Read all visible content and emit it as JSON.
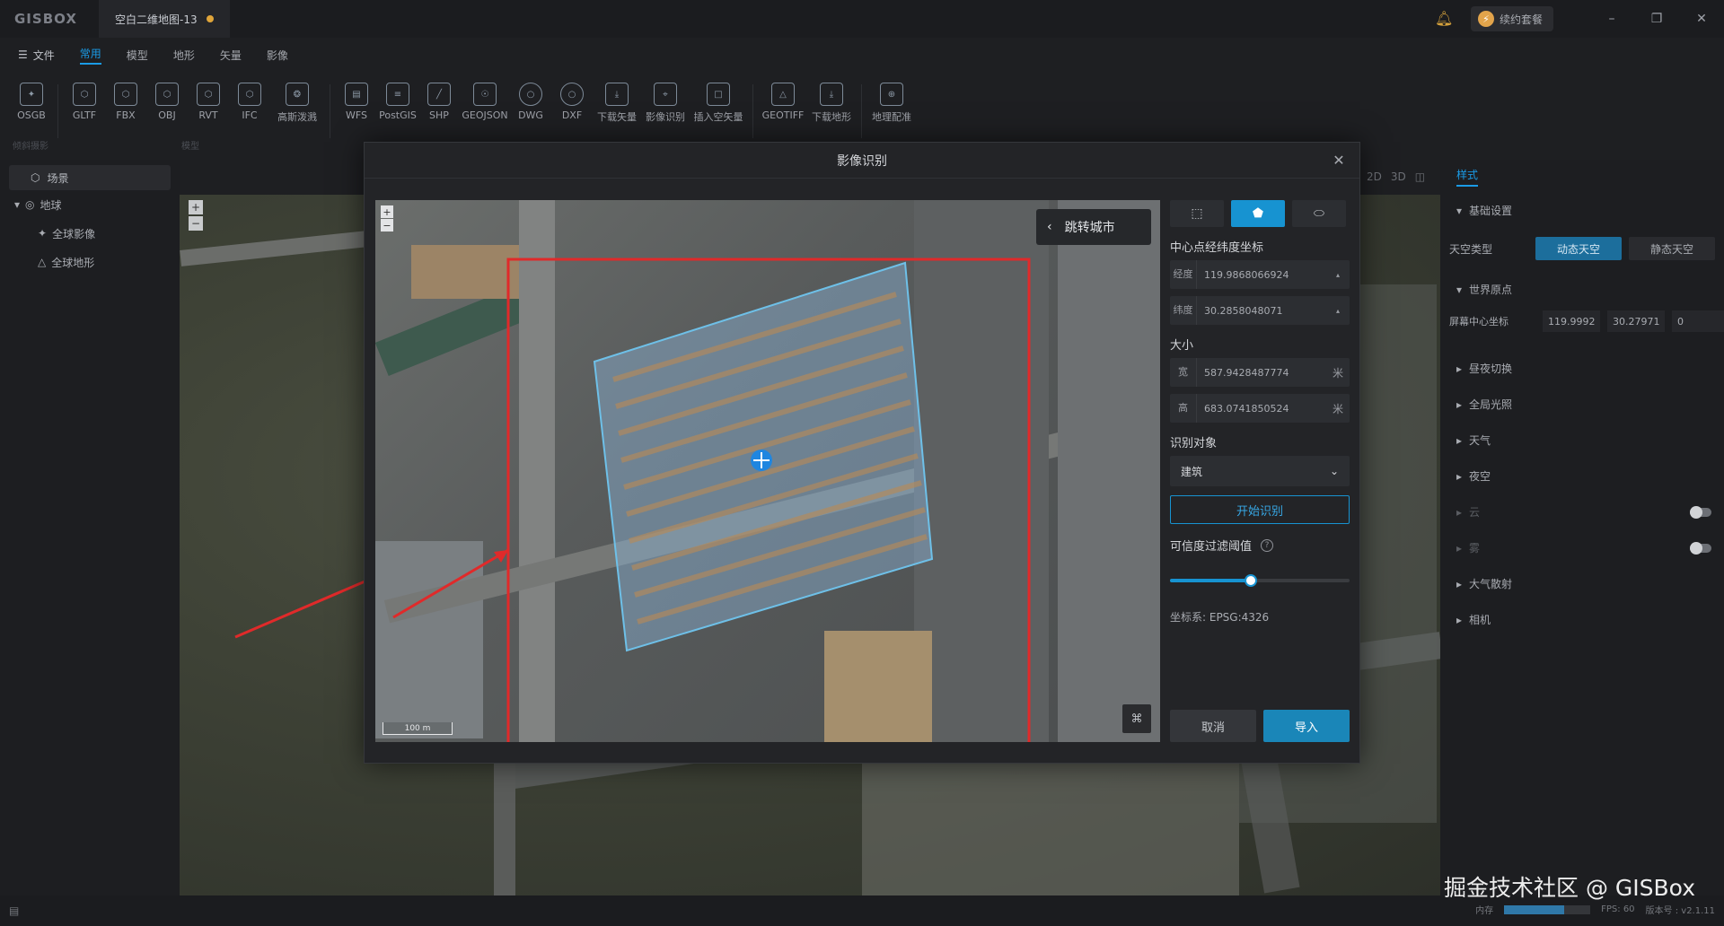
{
  "app": {
    "logo": "GISBOX",
    "doc_tab": "空白二维地图-13",
    "renew_label": "续约套餐",
    "renew_icon": "lightning-icon",
    "bell_icon": "bell-icon"
  },
  "menu": {
    "file": "文件",
    "tabs": [
      "常用",
      "模型",
      "地形",
      "矢量",
      "影像"
    ],
    "active_tab": "常用"
  },
  "ribbon": {
    "buttons": [
      "OSGB",
      "GLTF",
      "FBX",
      "OBJ",
      "RVT",
      "IFC",
      "高斯泼溅",
      "WFS",
      "PostGIS",
      "SHP",
      "GEOJSON",
      "DWG",
      "DXF",
      "下载矢量",
      "影像识别",
      "插入空矢量",
      "GEOTIFF",
      "下载地形",
      "地理配准"
    ],
    "groups": [
      "倾斜摄影",
      "模型"
    ]
  },
  "left_panel": {
    "header": "场景",
    "globe": "地球",
    "items": [
      "全球影像",
      "全球地形"
    ]
  },
  "view_modes": [
    "2D",
    "3D"
  ],
  "right_panel": {
    "tab": "样式",
    "basic": "基础设置",
    "sky_type_label": "天空类型",
    "sky_options": [
      "动态天空",
      "静态天空"
    ],
    "world_origin": "世界原点",
    "screen_center_label": "屏幕中心坐标",
    "screen_center": [
      "119.9992",
      "30.27971",
      "0"
    ],
    "sections": [
      "昼夜切换",
      "全局光照",
      "天气",
      "夜空",
      "云",
      "雾",
      "大气散射",
      "相机"
    ]
  },
  "modal": {
    "title": "影像识别",
    "jump_city": "跳转城市",
    "scale_text": "100 m",
    "center_label": "中心点经纬度坐标",
    "lon_prefix": "经度",
    "lon_value": "119.9868066924",
    "lat_prefix": "纬度",
    "lat_value": "30.2858048071",
    "size_label": "大小",
    "width_prefix": "宽",
    "width_value": "587.9428487774",
    "height_prefix": "高",
    "height_value": "683.0741850524",
    "unit": "米",
    "target_label": "识别对象",
    "target_value": "建筑",
    "start_button": "开始识别",
    "threshold_label": "可信度过滤阈值",
    "threshold_value": 0.45,
    "crs": "坐标系: EPSG:4326",
    "cancel": "取消",
    "import": "导入"
  },
  "status": {
    "mem_label": "内存",
    "mem_fraction": 0.7,
    "fps": "FPS: 60",
    "version": "版本号 : v2.1.11"
  },
  "watermark": "掘金技术社区 @ GISBox"
}
